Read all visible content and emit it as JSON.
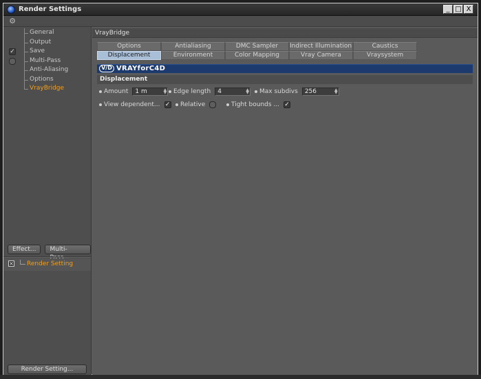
{
  "window": {
    "title": "Render Settings",
    "controls": [
      "_",
      "□",
      "X"
    ]
  },
  "left": {
    "tree": [
      {
        "label": "General",
        "check": ""
      },
      {
        "label": "Output",
        "check": ""
      },
      {
        "label": "Save",
        "check": "✓"
      },
      {
        "label": "Multi-Pass",
        "check": "round"
      },
      {
        "label": "Anti-Aliasing",
        "check": ""
      },
      {
        "label": "Options",
        "check": ""
      },
      {
        "label": "VrayBridge",
        "check": "",
        "active": true
      }
    ],
    "buttons": {
      "effect": "Effect...",
      "multipass": "Multi-Pass..."
    },
    "settings_item": "Render Setting",
    "render_button": "Render Setting..."
  },
  "right": {
    "panel_title": "VrayBridge",
    "tabs_row1": [
      "Options",
      "Antialiasing",
      "DMC Sampler",
      "Indirect Illumination (GI)",
      "Caustics"
    ],
    "tabs_row2": [
      "Displacement",
      "Environment",
      "Color Mapping",
      "Vray Camera",
      "Vraysystem"
    ],
    "active_tab": "Displacement",
    "banner_logo": "VRAYforC4D",
    "banner_mark": "V/D",
    "section": "Displacement",
    "params": {
      "amount_label": "Amount",
      "amount_value": "1 m",
      "edge_label": "Edge length",
      "edge_value": "4",
      "max_label": "Max subdivs",
      "max_value": "256",
      "view_label": "View dependent...",
      "view_check": "✓",
      "relative_label": "Relative",
      "tight_label": "Tight bounds ...",
      "tight_check": "✓"
    }
  },
  "colors": {
    "accent": "#f0a020",
    "banner": "#1c3a6e",
    "active_tab": "#a9bfd8"
  }
}
